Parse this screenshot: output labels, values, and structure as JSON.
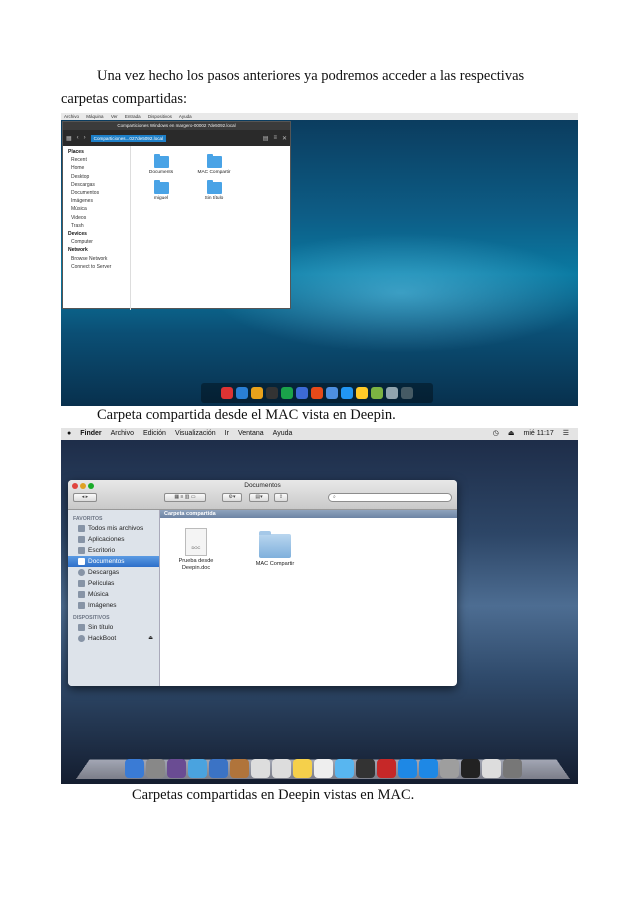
{
  "intro": {
    "line1": "Una vez hecho los pasos anteriores ya podremos acceder a las respectivas",
    "line2": "carpetas compartidas:"
  },
  "caption1": "Carpeta compartida desde el MAC vista en Deepin.",
  "caption2": "Carpetas compartidas en Deepin vistas en MAC.",
  "deepin": {
    "menubar": [
      "Archivo",
      "Máquina",
      "Ver",
      "Entrada",
      "Dispositivos",
      "Ayuda"
    ],
    "window_title": "Comparticiones Windows en margero-00002 7de5092.local",
    "crumb": "Comparticiones...027de5092.local",
    "sidebar": {
      "places_header": "Places",
      "places": [
        "Recent",
        "Home",
        "Desktop",
        "Descargas",
        "Documentos",
        "Imágenes",
        "Música",
        "Videos",
        "Trash"
      ],
      "devices_header": "Devices",
      "devices": [
        "Computer"
      ],
      "network_header": "Network",
      "network": [
        "Browse Network",
        "Connect to Server"
      ]
    },
    "files": [
      "Documents",
      "MAC Compartir",
      "miguel",
      "Sin título"
    ],
    "dock_colors": [
      "#d33",
      "#2a7fd4",
      "#e9a21b",
      "#333",
      "#1aa34a",
      "#3c6ad6",
      "#e64a19",
      "#4d8fe0",
      "#2196f3",
      "#ffca28",
      "#7cb342",
      "#90a4ae",
      "#455a64"
    ]
  },
  "mac": {
    "menubar": {
      "finder": "Finder",
      "items": [
        "Archivo",
        "Edición",
        "Visualización",
        "Ir",
        "Ventana",
        "Ayuda"
      ],
      "clock": "mié 11:17"
    },
    "window_title": "Documentos",
    "search_placeholder": "",
    "pathbar": "Carpeta compartida",
    "sidebar": {
      "favorites_header": "FAVORITOS",
      "favorites": [
        "Todos mis archivos",
        "Aplicaciones",
        "Escritorio",
        "Documentos",
        "Descargas",
        "Películas",
        "Música",
        "Imágenes"
      ],
      "selected": "Documentos",
      "devices_header": "DISPOSITIVOS",
      "devices": [
        "Sin título",
        "HackBoot"
      ]
    },
    "files": [
      {
        "name_line1": "Prueba desde",
        "name_line2": "Deepin.doc",
        "kind": "doc"
      },
      {
        "name_line1": "MAC Compartir",
        "name_line2": "",
        "kind": "folder"
      }
    ],
    "dock_colors": [
      "#3a7bd5",
      "#888",
      "#6a4c93",
      "#4aa3df",
      "#3b73c5",
      "#b0743b",
      "#ddd",
      "#ddd",
      "#f5d04b",
      "#eee",
      "#58b6f0",
      "#333",
      "#c62828",
      "#1e88e5",
      "#1e88e5",
      "#9e9e9e",
      "#222",
      "#ddd",
      "#777"
    ]
  }
}
